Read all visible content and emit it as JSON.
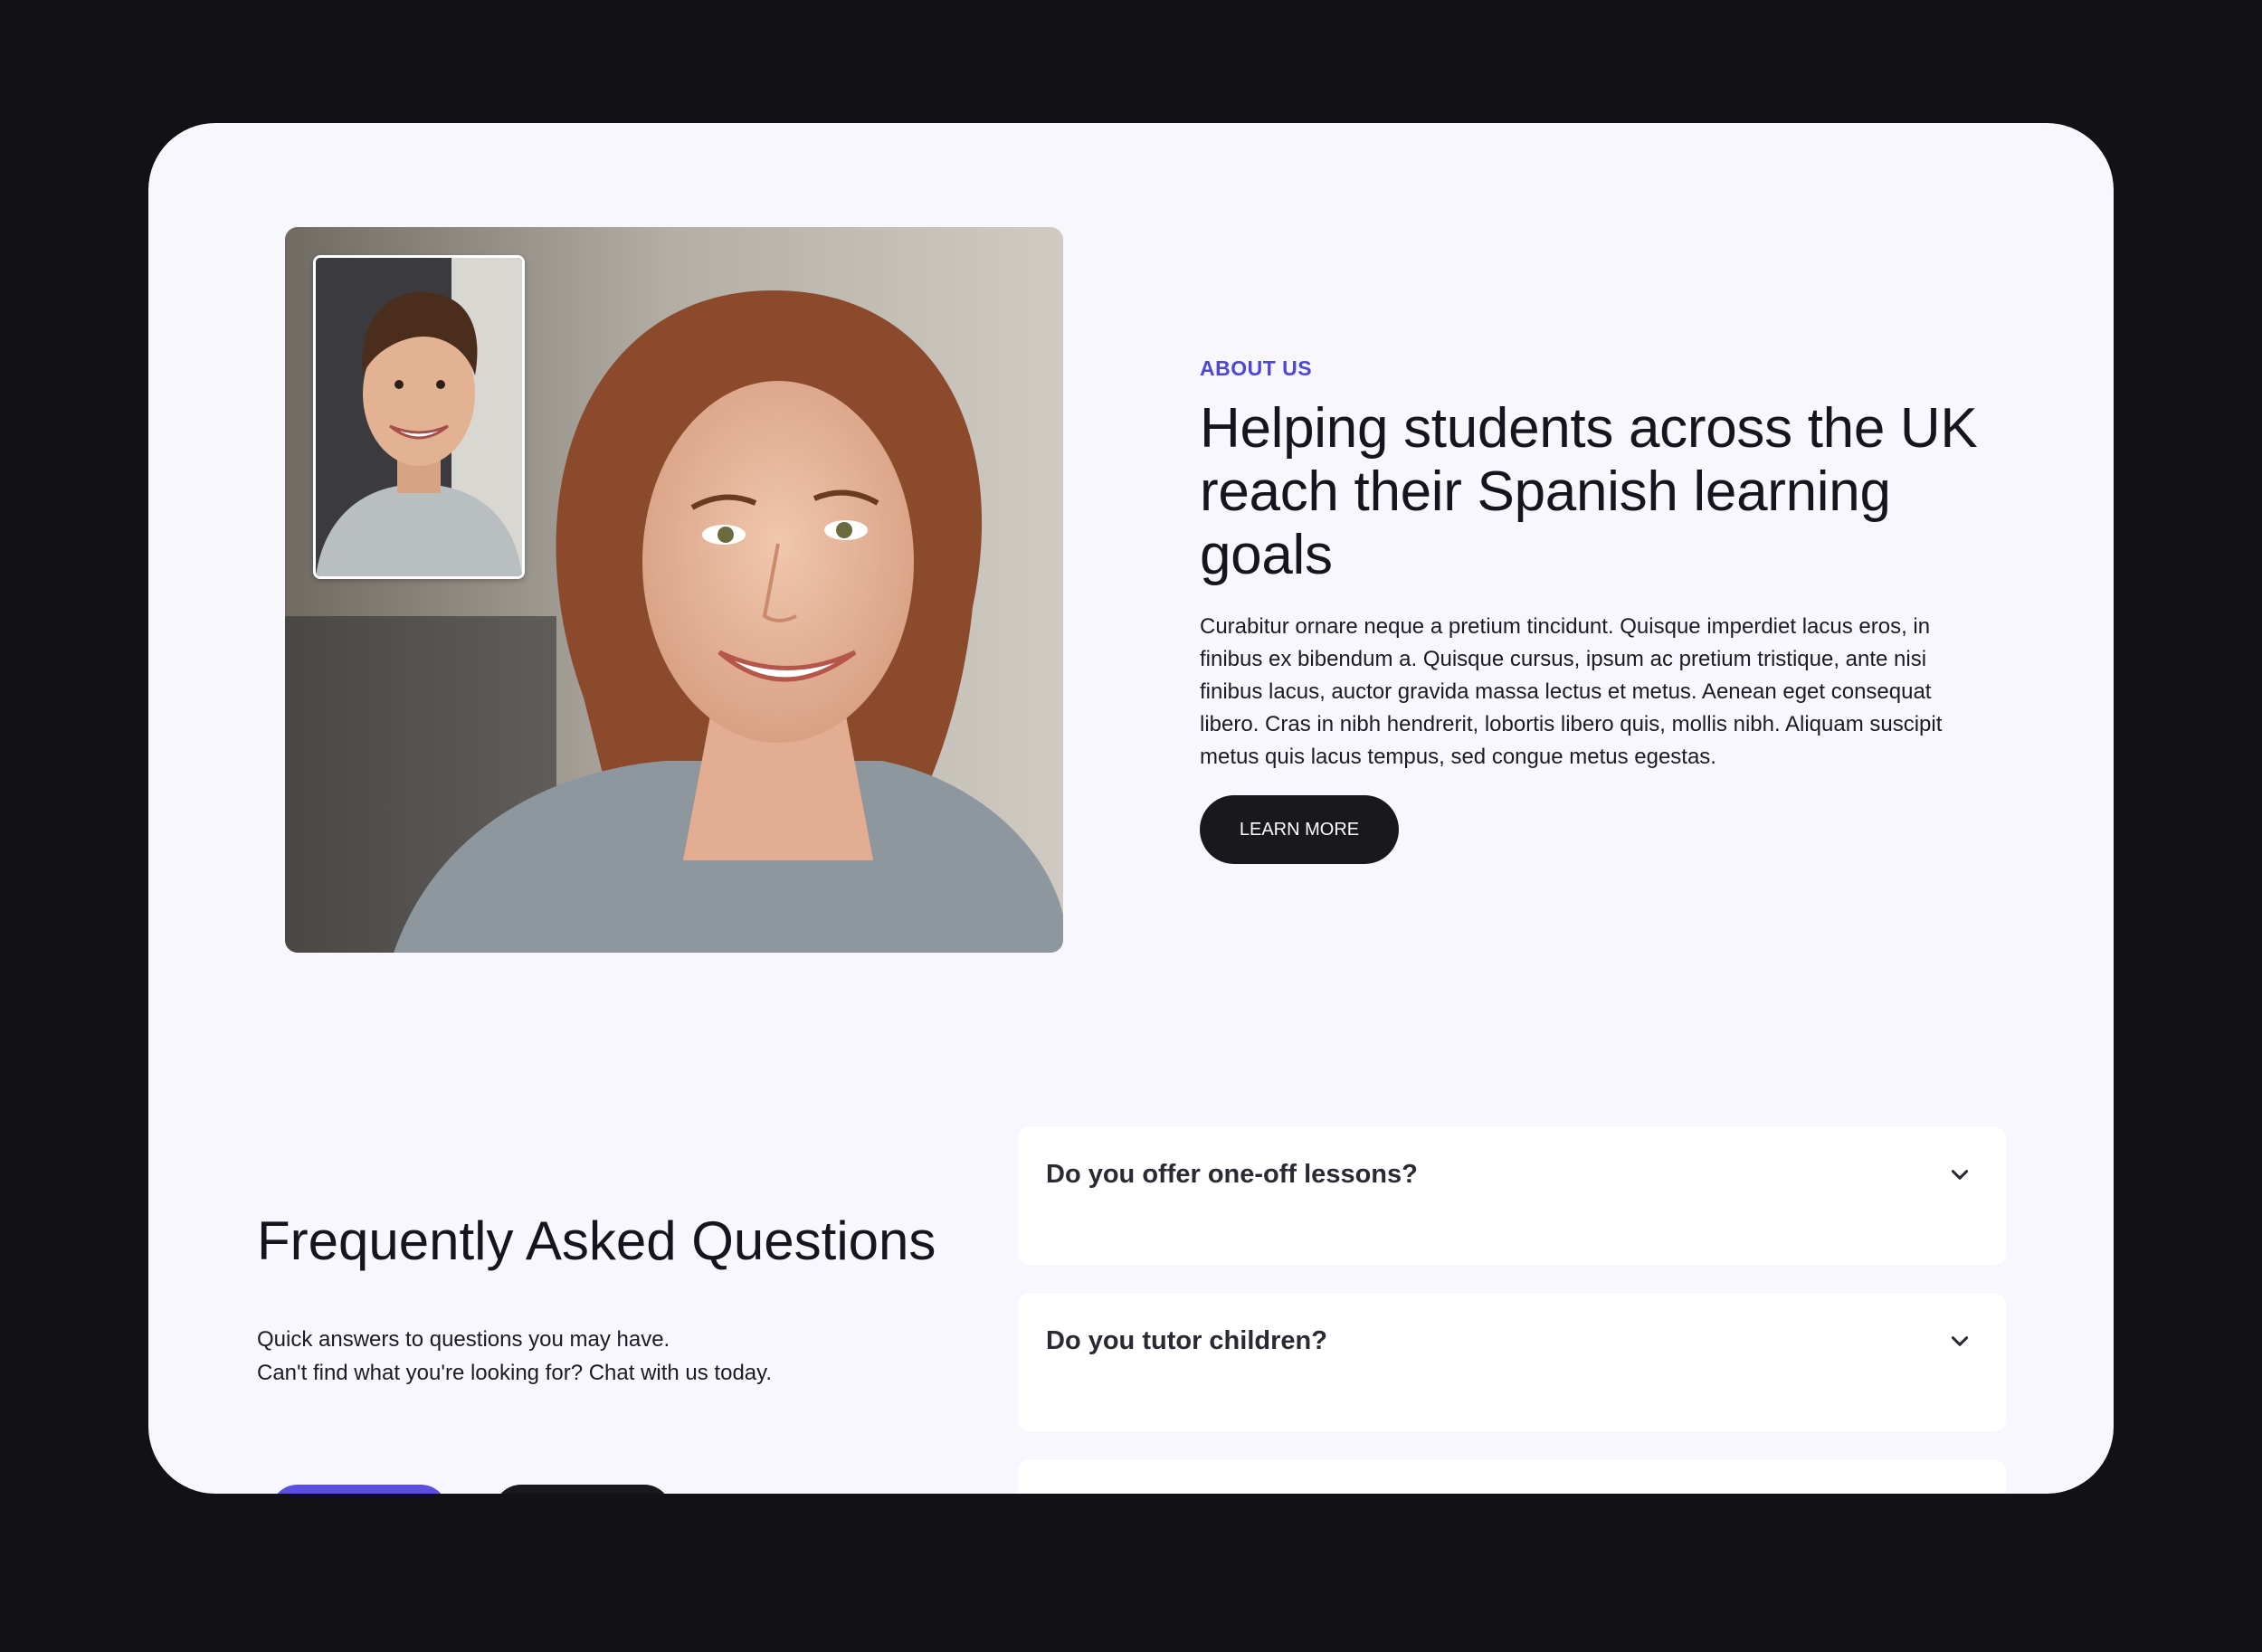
{
  "about": {
    "eyebrow": "ABOUT US",
    "title": "Helping students across the UK reach their Spanish learning goals",
    "body": "Curabitur ornare neque a pretium tincidunt. Quisque imperdiet lacus eros, in finibus ex bibendum a. Quisque cursus, ipsum ac pretium tristique, ante nisi finibus lacus, auctor gravida massa lectus et metus. Aenean eget consequat libero. Cras in nibh hendrerit, lobortis libero quis, mollis nibh. Aliquam suscipit metus quis lacus tempus, sed congue metus egestas.",
    "button_label": "LEARN MORE"
  },
  "faq": {
    "title": "Frequently Asked Questions",
    "subtitle_line1": "Quick answers to questions you may have.",
    "subtitle_line2": "Can't find what you're looking for? Chat with us today.",
    "items": [
      {
        "question": "Do you offer one-off lessons?"
      },
      {
        "question": "Do you tutor children?"
      },
      {
        "question": ""
      }
    ]
  },
  "colors": {
    "accent": "#4f46d6",
    "dark": "#18181d",
    "panel": "#f8f7fe",
    "background": "#111116"
  },
  "icons": {
    "faq_toggle": "chevron-down-icon"
  }
}
